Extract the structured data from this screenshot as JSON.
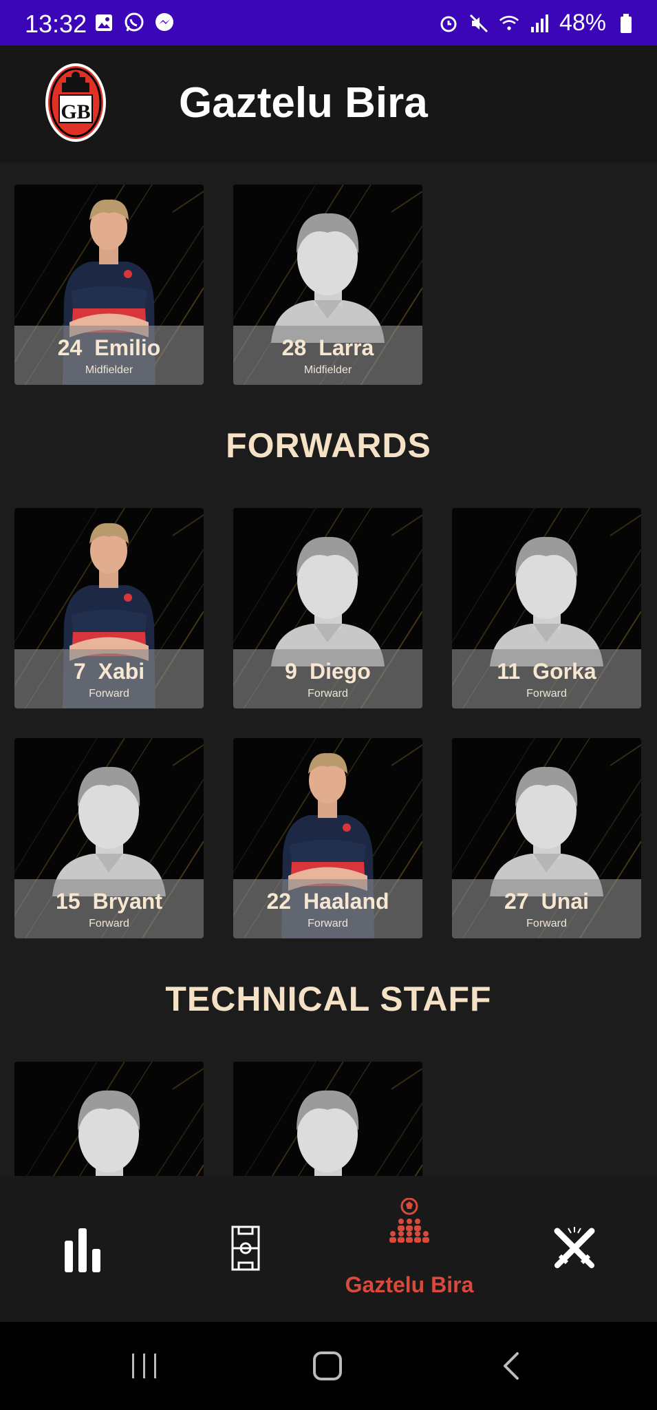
{
  "status": {
    "time": "13:32",
    "battery": "48%"
  },
  "header": {
    "title": "Gaztelu Bira"
  },
  "sections": {
    "forwards_title": "FORWARDS",
    "staff_title": "TECHNICAL STAFF"
  },
  "midfielders": [
    {
      "number": "24",
      "name": "Emilio",
      "position": "Midfielder",
      "photo": "player-photo"
    },
    {
      "number": "28",
      "name": "Larra",
      "position": "Midfielder",
      "photo": "silhouette"
    }
  ],
  "forwards": [
    {
      "number": "7",
      "name": "Xabi",
      "position": "Forward",
      "photo": "player-photo"
    },
    {
      "number": "9",
      "name": "Diego",
      "position": "Forward",
      "photo": "silhouette"
    },
    {
      "number": "11",
      "name": "Gorka",
      "position": "Forward",
      "photo": "silhouette"
    },
    {
      "number": "15",
      "name": "Bryant",
      "position": "Forward",
      "photo": "silhouette"
    },
    {
      "number": "22",
      "name": "Haaland",
      "position": "Forward",
      "photo": "player-photo"
    },
    {
      "number": "27",
      "name": "Unai",
      "position": "Forward",
      "photo": "silhouette"
    }
  ],
  "nav": {
    "active_label": "Gaztelu Bira",
    "items": [
      "stats-icon",
      "field-icon",
      "team-icon",
      "swords-icon"
    ]
  },
  "colors": {
    "status_bar": "#3a06b8",
    "accent": "#d94a3d",
    "section_title": "#f4e1c6"
  }
}
